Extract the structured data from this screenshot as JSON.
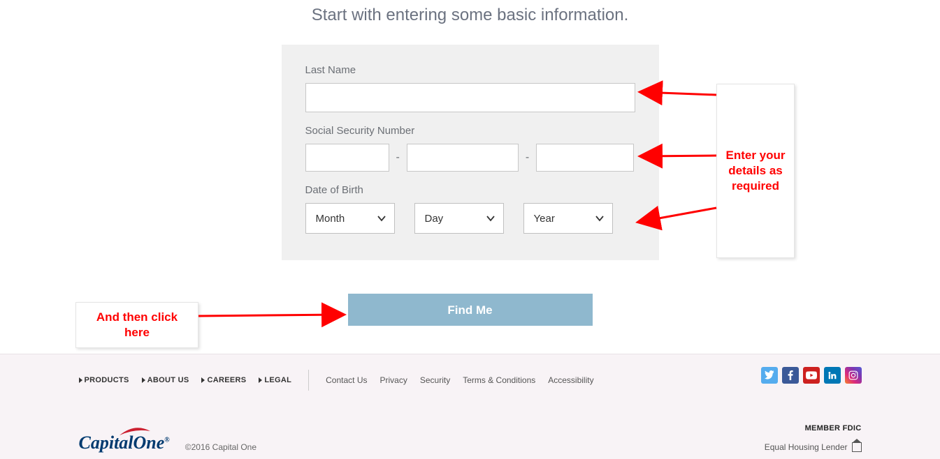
{
  "header": {
    "subtitle": "Start with entering some basic information."
  },
  "form": {
    "last_name_label": "Last Name",
    "ssn_label": "Social Security Number",
    "dob_label": "Date of Birth",
    "dob_month": "Month",
    "dob_day": "Day",
    "dob_year": "Year"
  },
  "action": {
    "find_me": "Find Me"
  },
  "callouts": {
    "right_text": "Enter your details as required",
    "left_text": "And then click here"
  },
  "footer": {
    "main_links": [
      "PRODUCTS",
      "ABOUT US",
      "CAREERS",
      "LEGAL"
    ],
    "sub_links": [
      "Contact Us",
      "Privacy",
      "Security",
      "Terms & Conditions",
      "Accessibility"
    ],
    "copyright": "©2016 Capital One",
    "member_fdic": "MEMBER FDIC",
    "ehl": "Equal Housing Lender",
    "logo_text": "CapitalOne"
  }
}
